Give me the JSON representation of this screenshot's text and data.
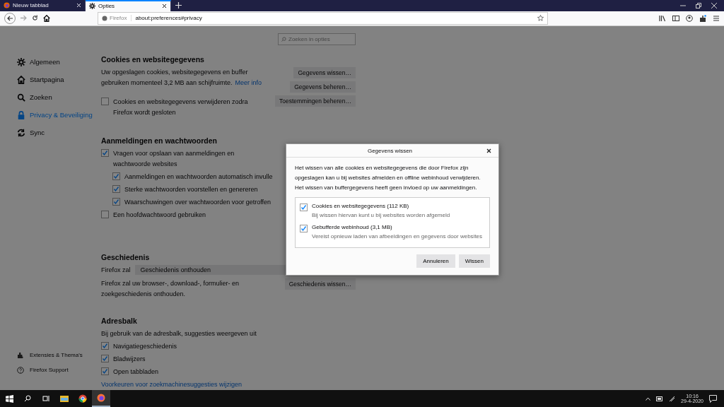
{
  "tabs": [
    {
      "title": "Nieuw tabblad",
      "selected": false
    },
    {
      "title": "Opties",
      "selected": true
    }
  ],
  "address_bar": {
    "identity": "Firefox",
    "url": "about:preferences#privacy"
  },
  "search": {
    "placeholder": "Zoeken in opties"
  },
  "sidebar": {
    "items": [
      {
        "label": "Algemeen",
        "selected": false
      },
      {
        "label": "Startpagina",
        "selected": false
      },
      {
        "label": "Zoeken",
        "selected": false
      },
      {
        "label": "Privacy & Beveiliging",
        "selected": true
      },
      {
        "label": "Sync",
        "selected": false
      }
    ],
    "footer": [
      {
        "label": "Extensies & Thema's"
      },
      {
        "label": "Firefox Support"
      }
    ]
  },
  "cookies": {
    "title": "Cookies en websitegegevens",
    "description": "Uw opgeslagen cookies, websitegegevens en buffer gebruiken momenteel 3,2 MB aan schijfruimte.",
    "link": "Meer info",
    "checkbox": {
      "label": "Cookies en websitegegevens verwijderen zodra Firefox wordt gesloten",
      "checked": false
    },
    "buttons": [
      "Gegevens wissen…",
      "Gegevens beheren…",
      "Toestemmingen beheren…"
    ]
  },
  "logins": {
    "title": "Aanmeldingen en wachtwoorden",
    "items": [
      {
        "label": "Vragen voor opslaan van aanmeldingen en wachtwoorde websites",
        "checked": true,
        "children": [
          {
            "label": "Aanmeldingen en wachtwoorden automatisch invulle",
            "checked": true
          },
          {
            "label": "Sterke wachtwoorden voorstellen en genereren",
            "checked": true
          },
          {
            "label": "Waarschuwingen over wachtwoorden voor getroffen",
            "checked": true
          }
        ]
      },
      {
        "label": "Een hoofdwachtwoord gebruiken",
        "checked": false
      }
    ]
  },
  "history": {
    "title": "Geschiedenis",
    "select_label": "Firefox zal",
    "select_value": "Geschiedenis onthouden",
    "description": "Firefox zal uw browser-, download-, formulier- en zoekgeschiedenis onthouden.",
    "button": "Geschiedenis wissen…"
  },
  "address_section": {
    "title": "Adresbalk",
    "description": "Bij gebruik van de adresbalk, suggesties weergeven uit",
    "items": [
      {
        "label": "Navigatiegeschiedenis",
        "checked": true
      },
      {
        "label": "Bladwijzers",
        "checked": true
      },
      {
        "label": "Open tabbladen",
        "checked": true
      }
    ],
    "link": "Voorkeuren voor zoekmachinesuggesties wijzigen"
  },
  "dialog": {
    "title": "Gegevens wissen",
    "text": "Het wissen van alle cookies en websitegegevens die door Firefox zijn opgeslagen kan u bij websites afmelden en offline webinhoud verwijderen. Het wissen van buffergegevens heeft geen invloed op uw aanmeldingen.",
    "options": [
      {
        "label": "Cookies en websitegegevens (112 KB)",
        "description": "Bij wissen hiervan kunt u bij websites worden afgemeld",
        "checked": true
      },
      {
        "label": "Gebufferde webinhoud (3,1 MB)",
        "description": "Vereist opnieuw laden van afbeeldingen en gegevens door websites",
        "checked": true
      }
    ],
    "buttons": [
      "Annuleren",
      "Wissen"
    ]
  },
  "taskbar": {
    "time": "10:16",
    "date": "29-4-2020"
  }
}
